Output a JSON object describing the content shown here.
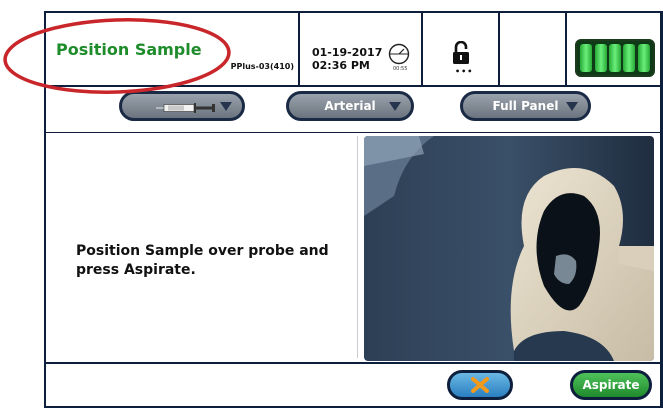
{
  "header": {
    "title": "Position Sample",
    "analyzer_id": "PPlus-03(410)",
    "date": "01-19-2017",
    "time": "02:36 PM",
    "timer_label": "00:55",
    "lock_dots": "•••",
    "battery_cells": 5
  },
  "selectors": {
    "sample_type_icon": "syringe-icon",
    "sample_source": "Arterial",
    "panel": "Full Panel"
  },
  "main": {
    "instruction": "Position Sample over probe and press Aspirate."
  },
  "footer": {
    "cancel_icon": "x-icon",
    "aspirate_label": "Aspirate"
  },
  "colors": {
    "title_green": "#1e8c2a",
    "frame_navy": "#0d1f3d",
    "annotation_red": "#c8262a",
    "aspirate_green": "#2eaa3a",
    "cancel_blue": "#3b8fd0",
    "cancel_x_orange": "#f29a1c"
  }
}
